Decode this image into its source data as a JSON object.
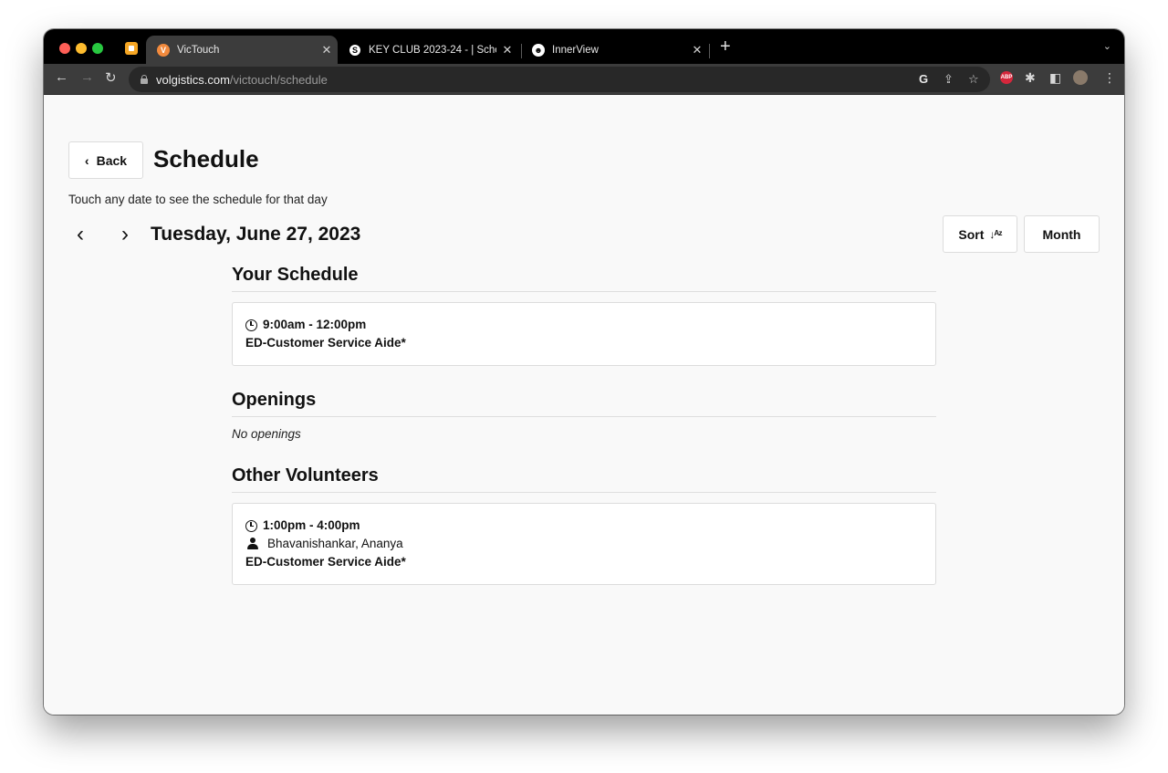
{
  "browser": {
    "tabs": [
      {
        "title": "VicTouch",
        "active": true,
        "favicon_color": "#f28a3d",
        "favicon_glyph": "V"
      },
      {
        "title": "KEY CLUB 2023-24 - | Schoo",
        "active": false,
        "favicon_color": "#4a6a8a",
        "favicon_glyph": "S"
      },
      {
        "title": "InnerView",
        "active": false,
        "favicon_color": "#222222",
        "favicon_glyph": "☻"
      }
    ],
    "url_domain": "volgistics.com",
    "url_path": "/victouch/schedule"
  },
  "page": {
    "back_label": "Back",
    "title": "Schedule",
    "hint": "Touch any date to see the schedule for that day",
    "date": "Tuesday, June 27, 2023",
    "sort_label": "Sort",
    "month_label": "Month"
  },
  "your_schedule": {
    "heading": "Your Schedule",
    "time": "9:00am - 12:00pm",
    "assignment": "ED-Customer Service Aide*"
  },
  "openings": {
    "heading": "Openings",
    "empty_text": "No openings"
  },
  "other_volunteers": {
    "heading": "Other Volunteers",
    "time": "1:00pm - 4:00pm",
    "volunteer": "Bhavanishankar, Ananya",
    "assignment": "ED-Customer Service Aide*"
  }
}
